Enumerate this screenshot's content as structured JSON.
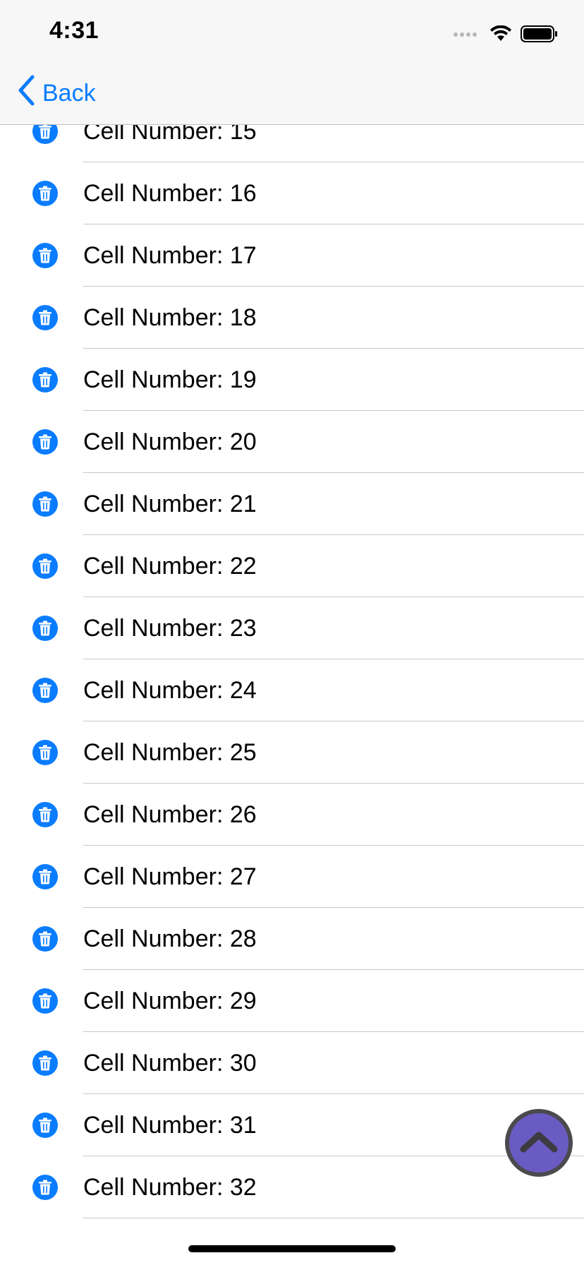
{
  "status_bar": {
    "time": "4:31",
    "icons": [
      "signal-icon",
      "wifi-icon",
      "battery-icon"
    ]
  },
  "nav": {
    "back_label": "Back"
  },
  "list": {
    "row_icon": "trash-icon",
    "rows": [
      {
        "label": "Cell Number: 15"
      },
      {
        "label": "Cell Number: 16"
      },
      {
        "label": "Cell Number: 17"
      },
      {
        "label": "Cell Number: 18"
      },
      {
        "label": "Cell Number: 19"
      },
      {
        "label": "Cell Number: 20"
      },
      {
        "label": "Cell Number: 21"
      },
      {
        "label": "Cell Number: 22"
      },
      {
        "label": "Cell Number: 23"
      },
      {
        "label": "Cell Number: 24"
      },
      {
        "label": "Cell Number: 25"
      },
      {
        "label": "Cell Number: 26"
      },
      {
        "label": "Cell Number: 27"
      },
      {
        "label": "Cell Number: 28"
      },
      {
        "label": "Cell Number: 29"
      },
      {
        "label": "Cell Number: 30"
      },
      {
        "label": "Cell Number: 31"
      },
      {
        "label": "Cell Number: 32"
      }
    ]
  },
  "fab": {
    "icon": "chevron-up-icon"
  },
  "colors": {
    "accent": "#0a7cff",
    "fab": "#6a5bc3",
    "fab_border": "#4a4a4f"
  }
}
